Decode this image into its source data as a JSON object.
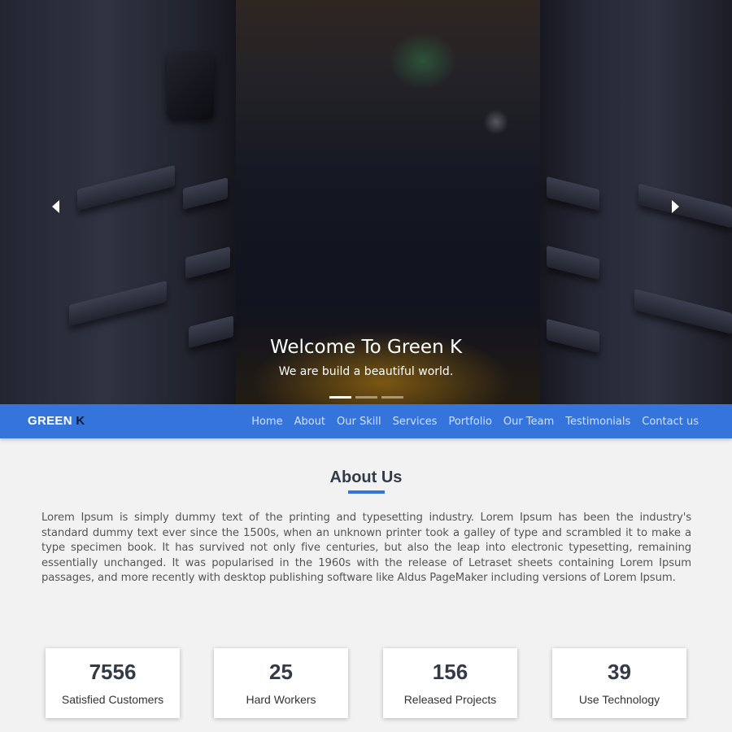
{
  "hero": {
    "title": "Welcome To Green K",
    "subtitle": "We are build a beautiful world.",
    "prev_icon": "chevron-left-icon",
    "next_icon": "chevron-right-icon",
    "slides_count": 3,
    "active_slide": 1
  },
  "navbar": {
    "brand_main": "GREEN",
    "brand_accent": "K",
    "background_color": "#3575db",
    "links": [
      "Home",
      "About",
      "Our Skill",
      "Services",
      "Portfolio",
      "Our Team",
      "Testimonials",
      "Contact us"
    ]
  },
  "about": {
    "title": "About Us",
    "accent_color": "#3575db",
    "text": "Lorem Ipsum is simply dummy text of the printing and typesetting industry. Lorem Ipsum has been the industry's standard dummy text ever since the 1500s, when an unknown printer took a galley of type and scrambled it to make a type specimen book. It has survived not only five centuries, but also the leap into electronic typesetting, remaining essentially unchanged. It was popularised in the 1960s with the release of Letraset sheets containing Lorem Ipsum passages, and more recently with desktop publishing software like Aldus PageMaker including versions of Lorem Ipsum."
  },
  "stats": [
    {
      "number": "7556",
      "label": "Satisfied Customers"
    },
    {
      "number": "25",
      "label": "Hard Workers"
    },
    {
      "number": "156",
      "label": "Released Projects"
    },
    {
      "number": "39",
      "label": "Use Technology"
    }
  ]
}
